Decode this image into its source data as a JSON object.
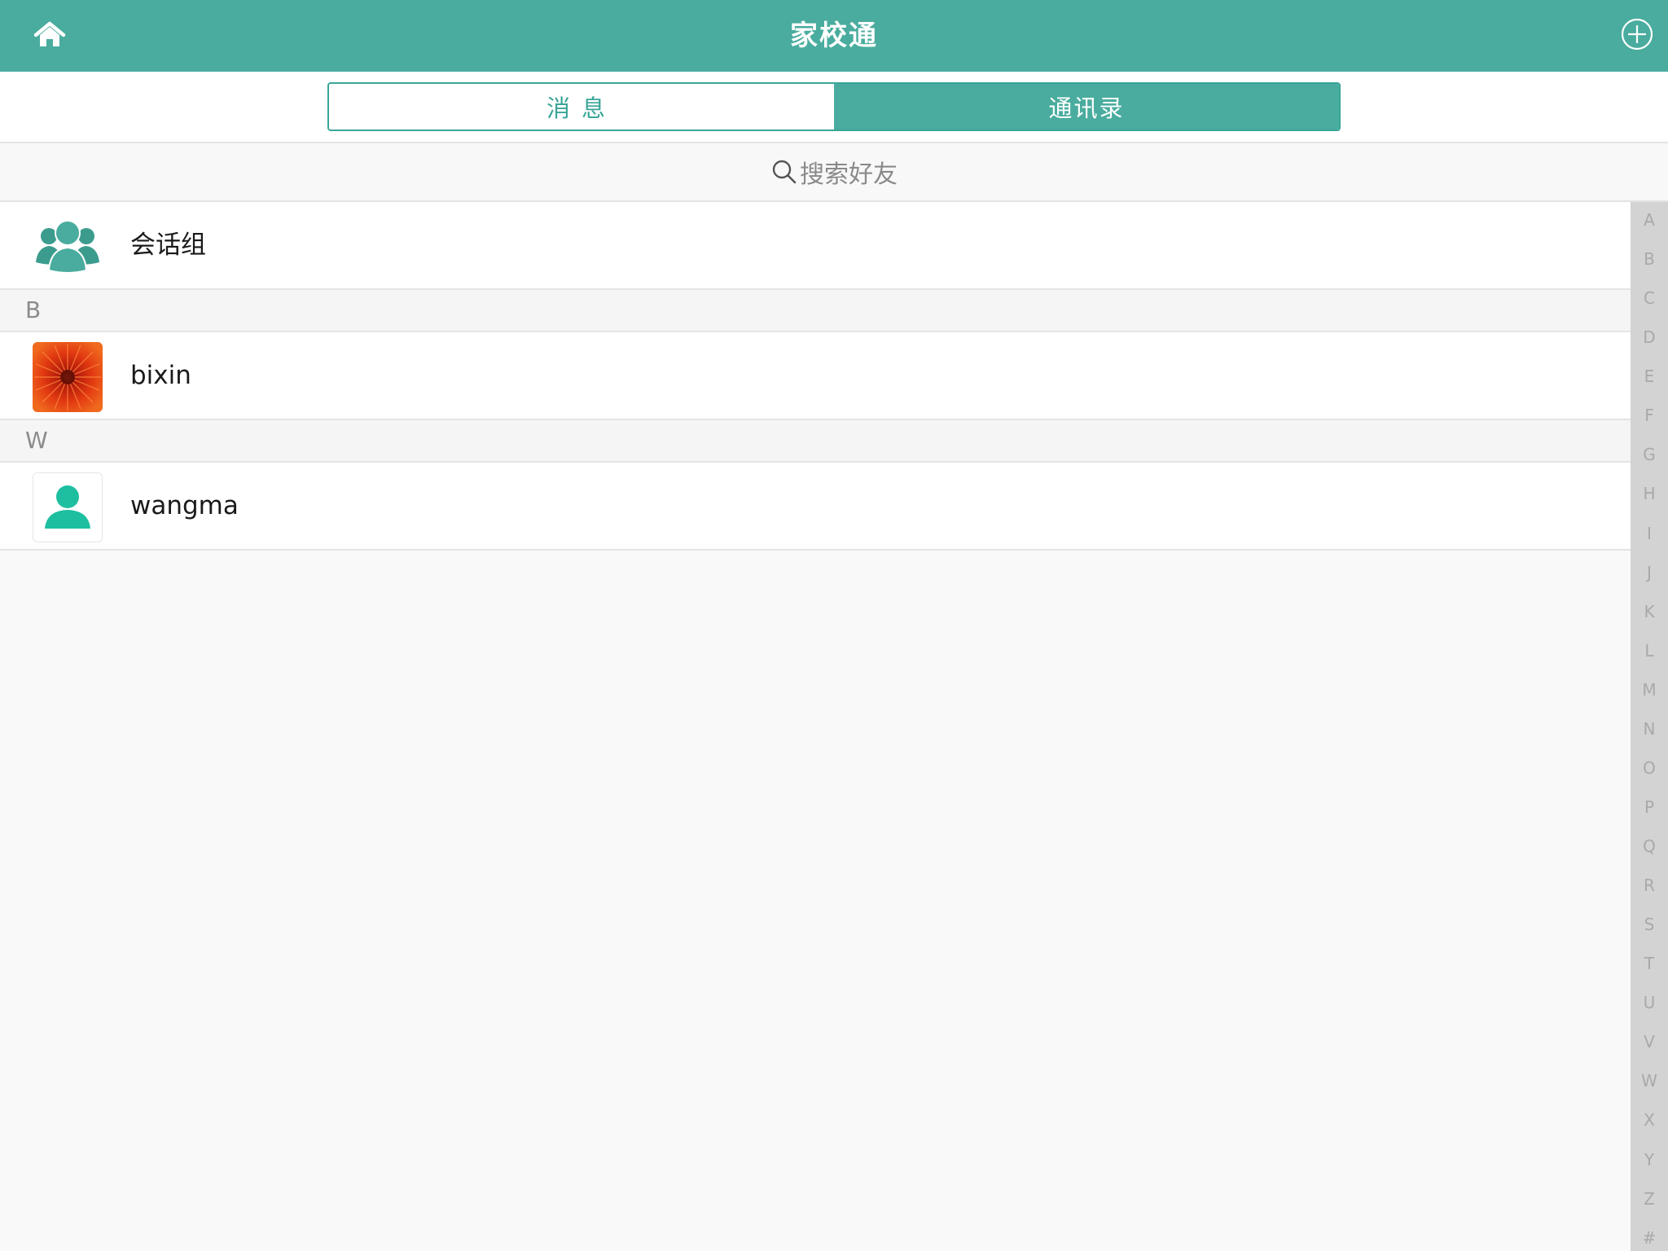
{
  "header": {
    "title": "家校通",
    "home_icon": "home-icon",
    "add_icon": "plus-circle-icon",
    "background": "#49ac9e"
  },
  "tabs": [
    {
      "label": "消息",
      "active": false
    },
    {
      "label": "通讯录",
      "active": true
    }
  ],
  "search": {
    "placeholder": "搜索好友",
    "icon": "search-icon"
  },
  "group_entry": {
    "label": "会话组",
    "icon": "group-icon"
  },
  "sections": [
    {
      "letter": "B",
      "contacts": [
        {
          "name": "bixin",
          "avatar": "flower-photo"
        }
      ]
    },
    {
      "letter": "W",
      "contacts": [
        {
          "name": "wangma",
          "avatar": "person-icon"
        }
      ]
    }
  ],
  "index_letters": [
    "A",
    "B",
    "C",
    "D",
    "E",
    "F",
    "G",
    "H",
    "I",
    "J",
    "K",
    "L",
    "M",
    "N",
    "O",
    "P",
    "Q",
    "R",
    "S",
    "T",
    "U",
    "V",
    "W",
    "X",
    "Y",
    "Z",
    "#"
  ],
  "colors": {
    "accent": "#49ac9e",
    "accent_dark": "#3aa597",
    "person_icon": "#1dbfa0",
    "index_bar": "#d3d3d3"
  }
}
